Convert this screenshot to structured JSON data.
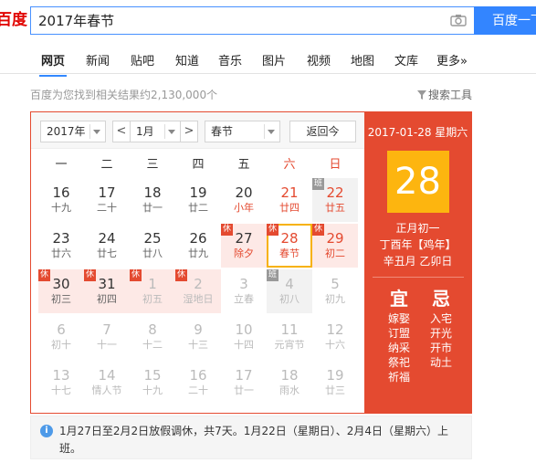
{
  "header": {
    "logo": "百度",
    "search_value": "2017年春节",
    "search_button": "百度一下"
  },
  "tabs": [
    "网页",
    "新闻",
    "贴吧",
    "知道",
    "音乐",
    "图片",
    "视频",
    "地图",
    "文库",
    "更多»"
  ],
  "result_count": "百度为您找到相关结果约2,130,000个",
  "search_tools": "搜索工具",
  "calendar": {
    "year_select": "2017年",
    "month_prev": "<",
    "month_select": "1月",
    "month_next": ">",
    "holiday_select": "春节",
    "back_today": "返回今",
    "weekdays": [
      "一",
      "二",
      "三",
      "四",
      "五",
      "六",
      "日"
    ],
    "rows": [
      [
        {
          "d": "16",
          "l": "十九"
        },
        {
          "d": "17",
          "l": "二十"
        },
        {
          "d": "18",
          "l": "廿一"
        },
        {
          "d": "19",
          "l": "廿二"
        },
        {
          "d": "20",
          "l": "小年",
          "festival": true
        },
        {
          "d": "21",
          "l": "廿四",
          "red": true
        },
        {
          "d": "22",
          "l": "廿五",
          "red": true,
          "badge": "班",
          "type": "work"
        }
      ],
      [
        {
          "d": "23",
          "l": "廿六"
        },
        {
          "d": "24",
          "l": "廿七"
        },
        {
          "d": "25",
          "l": "廿八"
        },
        {
          "d": "26",
          "l": "廿九"
        },
        {
          "d": "27",
          "l": "除夕",
          "festival": true,
          "badge": "休",
          "type": "rest"
        },
        {
          "d": "28",
          "l": "春节",
          "red": true,
          "badge": "休",
          "type": "selected"
        },
        {
          "d": "29",
          "l": "初二",
          "red": true,
          "badge": "休",
          "type": "rest"
        }
      ],
      [
        {
          "d": "30",
          "l": "初三",
          "badge": "休",
          "type": "rest"
        },
        {
          "d": "31",
          "l": "初四",
          "badge": "休",
          "type": "rest"
        },
        {
          "d": "1",
          "l": "初五",
          "dim": true,
          "badge": "休",
          "type": "rest"
        },
        {
          "d": "2",
          "l": "湿地日",
          "dim": true,
          "badge": "休",
          "type": "rest"
        },
        {
          "d": "3",
          "l": "立春",
          "dim": true
        },
        {
          "d": "4",
          "l": "初八",
          "dim": true,
          "badge": "班",
          "type": "work",
          "badge_gray": true
        },
        {
          "d": "5",
          "l": "初九",
          "dim": true
        }
      ],
      [
        {
          "d": "6",
          "l": "初十",
          "dim": true
        },
        {
          "d": "7",
          "l": "十一",
          "dim": true
        },
        {
          "d": "8",
          "l": "十二",
          "dim": true
        },
        {
          "d": "9",
          "l": "十三",
          "dim": true
        },
        {
          "d": "10",
          "l": "十四",
          "dim": true
        },
        {
          "d": "11",
          "l": "元宵节",
          "dim": true
        },
        {
          "d": "12",
          "l": "十六",
          "dim": true
        }
      ],
      [
        {
          "d": "13",
          "l": "十七",
          "dim": true
        },
        {
          "d": "14",
          "l": "情人节",
          "dim": true
        },
        {
          "d": "15",
          "l": "十九",
          "dim": true
        },
        {
          "d": "16",
          "l": "二十",
          "dim": true
        },
        {
          "d": "17",
          "l": "廿一",
          "dim": true
        },
        {
          "d": "18",
          "l": "雨水",
          "dim": true
        },
        {
          "d": "19",
          "l": "廿三",
          "dim": true
        }
      ]
    ],
    "detail": {
      "date_line": "2017-01-28 星期六",
      "day": "28",
      "lunar_day": "正月初一",
      "ganzhi_year": "丁酉年【鸡年】",
      "ganzhi_month_day": "辛丑月 乙卯日",
      "yi_label": "宜",
      "ji_label": "忌",
      "yi_items": [
        "嫁娶",
        "订盟",
        "纳采",
        "祭祀",
        "祈福"
      ],
      "ji_items": [
        "入宅",
        "开光",
        "开市",
        "动土"
      ]
    }
  },
  "notice": "1月27日至2月2日放假调休，共7天。1月22日（星期日）、2月4日（星期六）上班。",
  "colors": {
    "accent_blue": "#3385ff",
    "calendar_red": "#e44a30",
    "highlight_yellow": "#fdb50f",
    "rest_bg": "#fde9e6"
  }
}
